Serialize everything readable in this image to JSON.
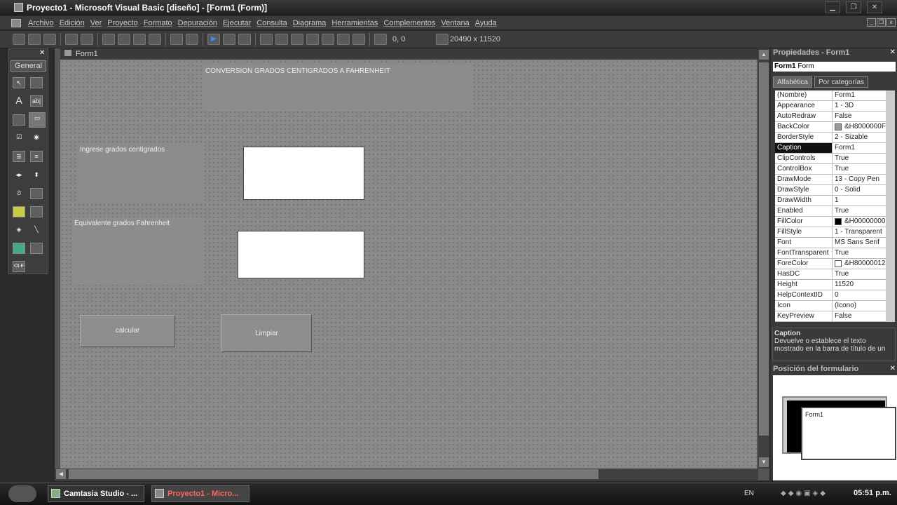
{
  "window": {
    "title": "Proyecto1 - Microsoft Visual Basic [diseño] - [Form1 (Form)]"
  },
  "menu": [
    "Archivo",
    "Edición",
    "Ver",
    "Proyecto",
    "Formato",
    "Depuración",
    "Ejecutar",
    "Consulta",
    "Diagrama",
    "Herramientas",
    "Complementos",
    "Ventana",
    "Ayuda"
  ],
  "toolbar": {
    "position": "0, 0",
    "size": "20490 x 11520"
  },
  "toolbox": {
    "tab": "General"
  },
  "form": {
    "title": "Form1",
    "heading": "CONVERSION GRADOS CENTIGRADOS A FAHRENHEIT",
    "label1": "Ingrese grados centigrados",
    "label2": "Equivalente grados Fahrenheit",
    "btn_calc": "calcular",
    "btn_clear": "Limpiar"
  },
  "props": {
    "header": "Propiedades - Form1",
    "object_name": "Form1",
    "object_type": "Form",
    "tab_alpha": "Alfabética",
    "tab_cat": "Por categorías",
    "rows": [
      {
        "n": "(Nombre)",
        "v": "Form1"
      },
      {
        "n": "Appearance",
        "v": "1 - 3D"
      },
      {
        "n": "AutoRedraw",
        "v": "False"
      },
      {
        "n": "BackColor",
        "v": "&H8000000F",
        "c": "#999999"
      },
      {
        "n": "BorderStyle",
        "v": "2 - Sizable"
      },
      {
        "n": "Caption",
        "v": "Form1"
      },
      {
        "n": "ClipControls",
        "v": "True"
      },
      {
        "n": "ControlBox",
        "v": "True"
      },
      {
        "n": "DrawMode",
        "v": "13 - Copy Pen"
      },
      {
        "n": "DrawStyle",
        "v": "0 - Solid"
      },
      {
        "n": "DrawWidth",
        "v": "1"
      },
      {
        "n": "Enabled",
        "v": "True"
      },
      {
        "n": "FillColor",
        "v": "&H00000000",
        "c": "#000000"
      },
      {
        "n": "FillStyle",
        "v": "1 - Transparent"
      },
      {
        "n": "Font",
        "v": "MS Sans Serif"
      },
      {
        "n": "FontTransparent",
        "v": "True"
      },
      {
        "n": "ForeColor",
        "v": "&H80000012",
        "c": "#ffffff"
      },
      {
        "n": "HasDC",
        "v": "True"
      },
      {
        "n": "Height",
        "v": "11520"
      },
      {
        "n": "HelpContextID",
        "v": "0"
      },
      {
        "n": "Icon",
        "v": "(Icono)"
      },
      {
        "n": "KeyPreview",
        "v": "False"
      }
    ],
    "desc_title": "Caption",
    "desc_text": "Devuelve o establece el texto mostrado en la barra de título de un",
    "pos_header": "Posición del formulario",
    "pos_form": "Form1"
  },
  "taskbar": {
    "task1": "Camtasia Studio - ...",
    "task2": "Proyecto1 - Micro...",
    "lang": "EN",
    "clock": "05:51 p.m."
  }
}
